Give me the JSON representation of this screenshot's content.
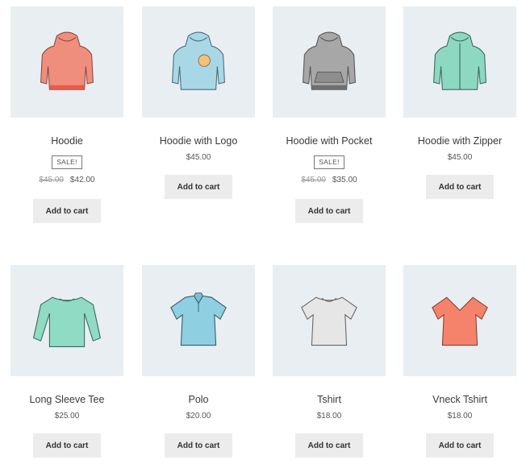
{
  "products": [
    {
      "name": "Hoodie",
      "sale": "SALE!",
      "old_price": "$45.00",
      "price": "$42.00",
      "button": "Add to cart",
      "icon": "hoodie-icon",
      "color": "#f08e7e"
    },
    {
      "name": "Hoodie with Logo",
      "price": "$45.00",
      "button": "Add to cart",
      "icon": "hoodie-logo-icon",
      "color": "#a8d8e6"
    },
    {
      "name": "Hoodie with Pocket",
      "sale": "SALE!",
      "old_price": "$45.00",
      "price": "$35.00",
      "button": "Add to cart",
      "icon": "hoodie-pocket-icon",
      "color": "#a7a7a7"
    },
    {
      "name": "Hoodie with Zipper",
      "price": "$45.00",
      "button": "Add to cart",
      "icon": "hoodie-zipper-icon",
      "color": "#8dd8c1"
    },
    {
      "name": "Long Sleeve Tee",
      "price": "$25.00",
      "button": "Add to cart",
      "icon": "long-sleeve-tee-icon",
      "color": "#8fdbc4"
    },
    {
      "name": "Polo",
      "price": "$20.00",
      "button": "Add to cart",
      "icon": "polo-icon",
      "color": "#8fcfe2"
    },
    {
      "name": "Tshirt",
      "price": "$18.00",
      "button": "Add to cart",
      "icon": "tshirt-icon",
      "color": "#e6e6e6"
    },
    {
      "name": "Vneck Tshirt",
      "price": "$18.00",
      "button": "Add to cart",
      "icon": "vneck-tshirt-icon",
      "color": "#f5836c"
    }
  ]
}
